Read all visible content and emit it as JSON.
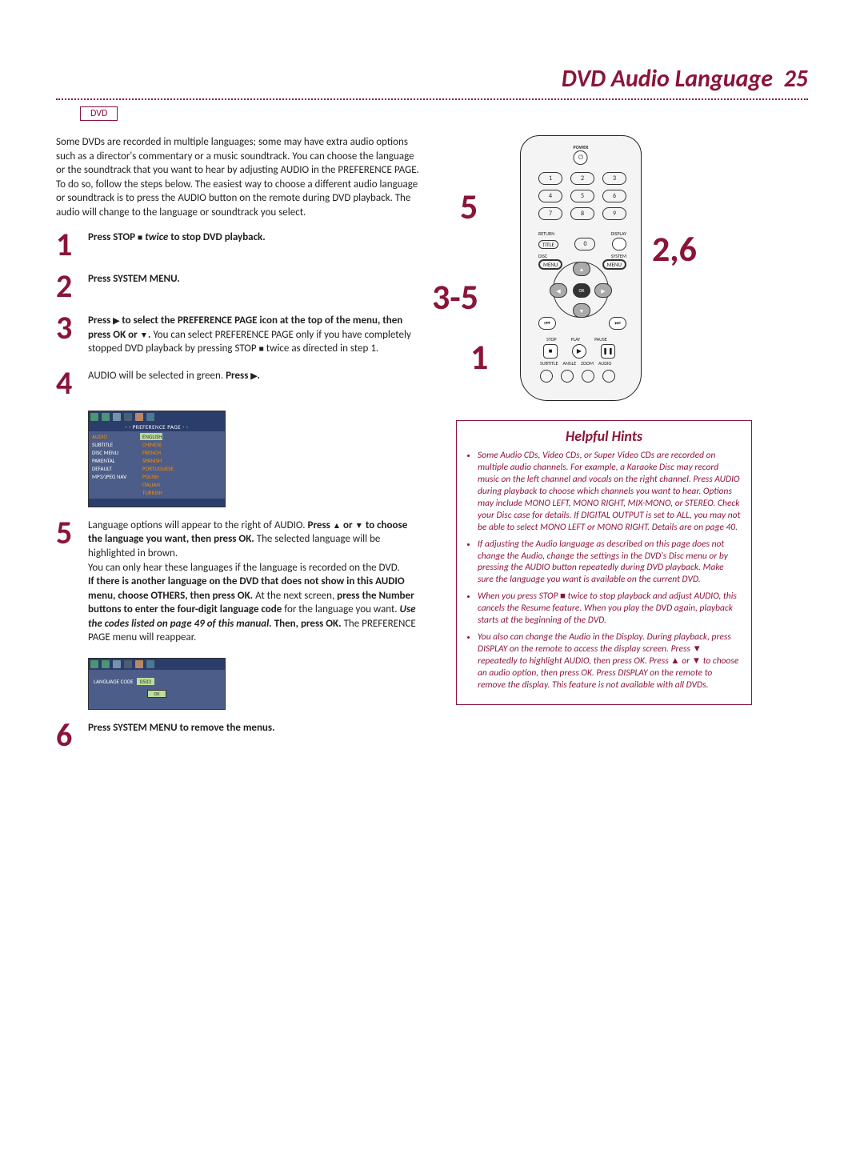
{
  "header": {
    "title": "DVD Audio Language",
    "page_number": "25",
    "badge": "DVD"
  },
  "intro": "Some DVDs are recorded in multiple languages; some may have extra audio options such as a director's commentary or a music soundtrack. You can choose the language or the soundtrack that you want to hear by adjusting AUDIO in the PREFERENCE PAGE.  To do so, follow the steps below. The easiest way to choose a different audio language or soundtrack is to press the AUDIO button on the remote during DVD playback. The audio will change to the language or soundtrack you select.",
  "steps": {
    "s1": {
      "num": "1",
      "b1": "Press STOP ",
      "i1": "twice",
      "t2": " to stop DVD playback."
    },
    "s2": {
      "num": "2",
      "b1": "Press SYSTEM MENU."
    },
    "s3": {
      "num": "3",
      "b1": "Press ",
      "b2": " to select the PREFERENCE PAGE icon at the top of the menu, then press OK or ",
      "b3": ".",
      "t1": " You can select PREFERENCE PAGE only if you have completely stopped DVD playback by pressing STOP ",
      "t2": " twice as directed in step 1."
    },
    "s4": {
      "num": "4",
      "t1": "AUDIO will be selected in green. ",
      "b1": "Press ",
      "b2": "."
    },
    "s5": {
      "num": "5",
      "t1": "Language options will appear to the right of AUDIO. ",
      "b1": "Press ",
      "b2": " or ",
      "b3": " to choose the language you want, then press OK.",
      "t2": " The selected language will be highlighted in brown.",
      "t3": "You can only hear these languages if the language is recorded on the DVD.",
      "b4": "If there is another language on the DVD that does not show in this AUDIO menu, choose OTHERS, then press OK.",
      "t4": " At the next screen, ",
      "b5": "press the Number buttons to enter the four-digit language code",
      "t5": " for the language you want. ",
      "i1": "Use the codes listed on page 49 of this manual.",
      "b6": " Then, press OK.",
      "t6": " The PREFERENCE PAGE menu will reappear."
    },
    "s6": {
      "num": "6",
      "b1": "Press SYSTEM MENU to remove the menus."
    }
  },
  "osd1": {
    "header": "- -  PREFERENCE  PAGE  - -",
    "rows": [
      {
        "label": "AUDIO",
        "value": "ENGLISH",
        "selected": true
      },
      {
        "label": "SUBTITLE",
        "value": "CHINESE"
      },
      {
        "label": "DISC MENU",
        "value": "FRENCH"
      },
      {
        "label": "PARENTAL",
        "value": "SPANISH"
      },
      {
        "label": "DEFAULT",
        "value": "PORTUGUESE"
      },
      {
        "label": "MP3/JPEG NAV",
        "value": "POLISH"
      },
      {
        "label": "",
        "value": "ITALIAN"
      },
      {
        "label": "",
        "value": "TURKISH"
      }
    ]
  },
  "osd2": {
    "label": "LANGUAGE CODE",
    "value": "0503",
    "ok": "OK"
  },
  "remote": {
    "labels": {
      "power": "POWER",
      "return": "RETURN",
      "display": "DISPLAY",
      "title": "TITLE",
      "disc": "DISC",
      "system": "SYSTEM",
      "menu_l": "MENU",
      "menu_r": "MENU",
      "stop": "STOP",
      "play": "PLAY",
      "pause": "PAUSE",
      "subtitle": "SUBTITLE",
      "angle": "ANGLE",
      "zoom": "ZOOM",
      "audio": "AUDIO",
      "ok": "OK"
    },
    "numbers": [
      "1",
      "2",
      "3",
      "4",
      "5",
      "6",
      "7",
      "8",
      "9",
      "0"
    ]
  },
  "callouts": {
    "c5": "5",
    "c35": "3-5",
    "c1": "1",
    "c26": "2,6"
  },
  "hints": {
    "title": "Helpful Hints",
    "items": [
      "Some Audio CDs, Video CDs, or Super Video CDs are recorded on multiple audio channels. For example, a Karaoke Disc may record music on the left channel and vocals on the right channel. Press AUDIO during playback to choose which channels you want to hear. Options may include MONO LEFT, MONO RIGHT, MIX-MONO, or STEREO. Check your Disc case for details. If DIGITAL OUTPUT is set to ALL, you may not be able to select MONO LEFT or MONO RIGHT. Details are on page 40.",
      "If adjusting the Audio language as described on this page does not change the Audio, change the settings in the DVD's Disc menu or by pressing the AUDIO button repeatedly during DVD playback. Make sure the language you want is available on the current DVD.",
      "When you press STOP ■ twice to stop playback and adjust AUDIO, this cancels the Resume feature. When you play the DVD again, playback starts at the beginning of the DVD.",
      "You also can change the Audio in the Display. During playback, press DISPLAY on the remote to access the display screen. Press ▼ repeatedly to highlight AUDIO, then press OK. Press ▲ or ▼ to choose an audio option, then press OK. Press DISPLAY on the remote to remove the display. This feature is not available with all DVDs."
    ]
  }
}
